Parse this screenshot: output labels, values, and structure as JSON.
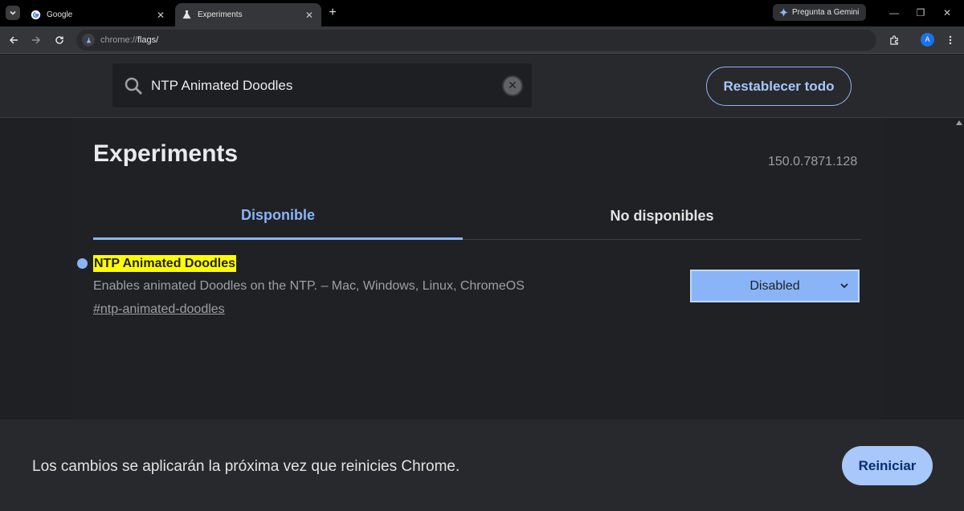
{
  "browser": {
    "tabs": [
      {
        "title": "Google",
        "favicon": "google-icon"
      },
      {
        "title": "Experiments",
        "favicon": "flask-icon"
      }
    ],
    "gemini_label": "Pregunta a Gemini",
    "url_prefix": "chrome://",
    "url_host": "flags/",
    "profile_initial": "A"
  },
  "flags_header": {
    "search_value": "NTP Animated Doodles",
    "reset_label": "Restablecer todo"
  },
  "main": {
    "title": "Experiments",
    "version": "150.0.7871.128",
    "tabs": [
      {
        "label": "Disponible",
        "selected": true
      },
      {
        "label": "No disponibles",
        "selected": false
      }
    ],
    "flag": {
      "name": "NTP Animated Doodles",
      "description": "Enables animated Doodles on the NTP. – Mac, Windows, Linux, ChromeOS",
      "link": "#ntp-animated-doodles",
      "selected_option": "Disabled"
    }
  },
  "bottom_bar": {
    "message": "Los cambios se aplicarán la próxima vez que reinicies Chrome.",
    "restart_label": "Reiniciar"
  },
  "colors": {
    "accent": "#8ab4f8",
    "highlight": "#ffff00",
    "background": "#202124"
  }
}
